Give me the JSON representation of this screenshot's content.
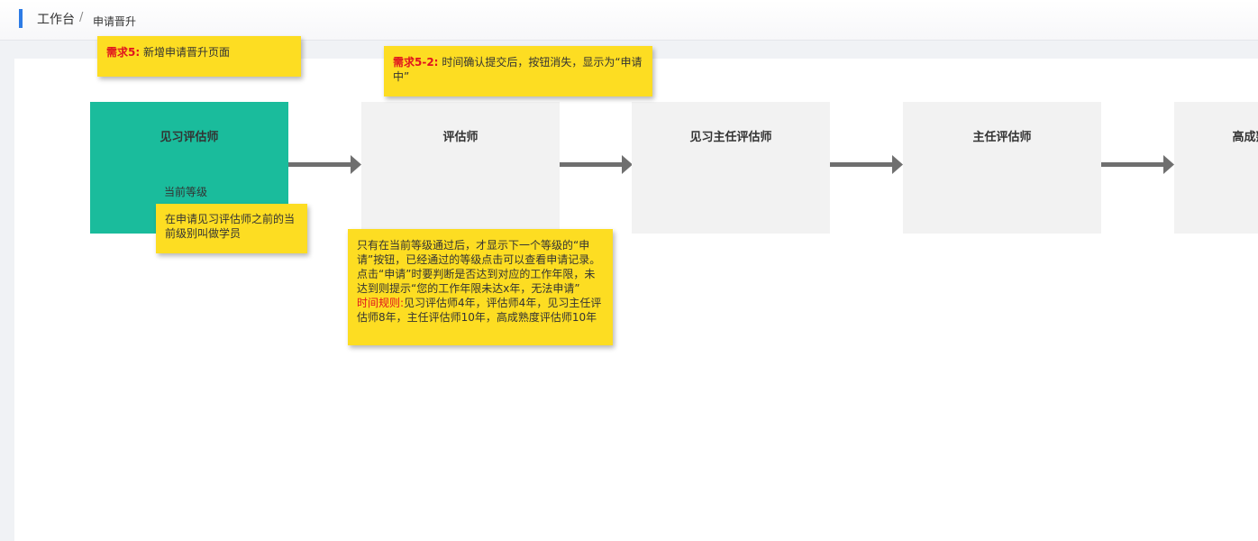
{
  "breadcrumb": {
    "root": "工作台",
    "separator": "/",
    "current": "申请晋升"
  },
  "levels": [
    {
      "title": "见习评估师",
      "current_label": "当前等级"
    },
    {
      "title": "评估师"
    },
    {
      "title": "见习主任评估师"
    },
    {
      "title": "主任评估师"
    },
    {
      "title": "高成熟度评估师"
    }
  ],
  "notes": {
    "req5": {
      "tag": "需求5:",
      "text": "新增申请晋升页面"
    },
    "req5_2": {
      "tag": "需求5-2:",
      "text": "时间确认提交后，按钮消失，显示为“申请中”"
    },
    "apprentice": {
      "text": "在申请见习评估师之前的当前级别叫做学员"
    },
    "rules": {
      "text": "只有在当前等级通过后，才显示下一个等级的“申请”按钮，已经通过的等级点击可以查看申请记录。点击“申请”时要判断是否达到对应的工作年限，未达到则提示“您的工作年限未达x年，无法申请”",
      "rule_tag": "时间规则:",
      "rule_text": "见习评估师4年，评估师4年，见习主任评估师8年，主任评估师10年，高成熟度评估师10年"
    }
  },
  "colors": {
    "accent": "#2d7be5",
    "current_level": "#1abc9c",
    "level_box": "#f2f2f2",
    "arrow": "#6f6f6f",
    "sticky_note": "#fddd22",
    "highlight": "#e0141e"
  }
}
